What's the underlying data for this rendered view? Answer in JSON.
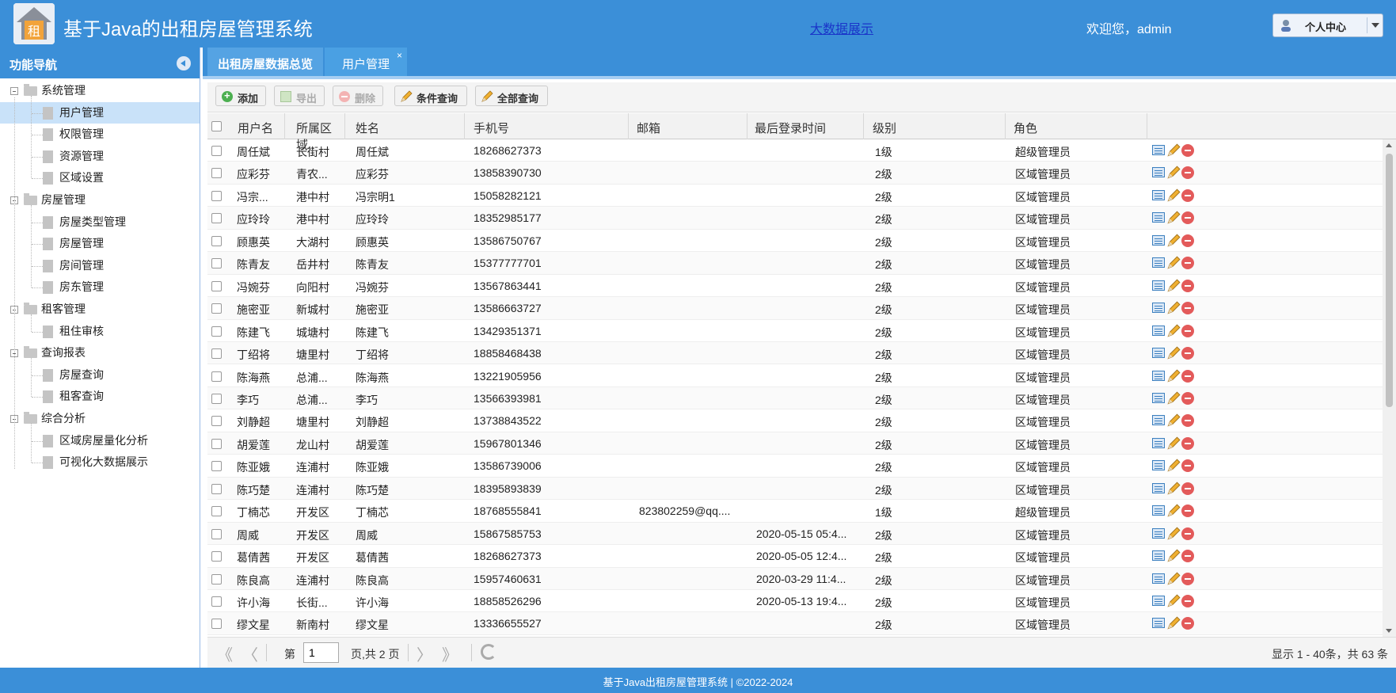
{
  "header": {
    "title": "基于Java的出租房屋管理系统",
    "bigdata_link": "大数据展示",
    "welcome": "欢迎您，admin",
    "user_center": "个人中心"
  },
  "sidebar": {
    "title": "功能导航",
    "groups": [
      {
        "label": "系统管理",
        "items": [
          "用户管理",
          "权限管理",
          "资源管理",
          "区域设置"
        ]
      },
      {
        "label": "房屋管理",
        "items": [
          "房屋类型管理",
          "房屋管理",
          "房间管理",
          "房东管理"
        ]
      },
      {
        "label": "租客管理",
        "items": [
          "租住审核"
        ]
      },
      {
        "label": "查询报表",
        "items": [
          "房屋查询",
          "租客查询"
        ]
      },
      {
        "label": "综合分析",
        "items": [
          "区域房屋量化分析",
          "可视化大数据展示"
        ]
      }
    ]
  },
  "tabs": [
    {
      "label": "出租房屋数据总览"
    },
    {
      "label": "用户管理",
      "close": "×"
    }
  ],
  "toolbar": {
    "add": "添加",
    "export": "导出",
    "delete": "删除",
    "condition_query": "条件查询",
    "all_query": "全部查询"
  },
  "grid": {
    "columns": [
      "用户名",
      "所属区域..",
      "姓名",
      "手机号",
      "邮箱",
      "最后登录时间",
      "级别",
      "角色"
    ],
    "rows": [
      [
        "周任斌",
        "长街村",
        "周任斌",
        "18268627373",
        "",
        "",
        "1级",
        "超级管理员"
      ],
      [
        "应彩芬",
        "青农...",
        "应彩芬",
        "13858390730",
        "",
        "",
        "2级",
        "区域管理员"
      ],
      [
        "冯宗...",
        "港中村",
        "冯宗明1",
        "15058282121",
        "",
        "",
        "2级",
        "区域管理员"
      ],
      [
        "应玲玲",
        "港中村",
        "应玲玲",
        "18352985177",
        "",
        "",
        "2级",
        "区域管理员"
      ],
      [
        "顾惠英",
        "大湖村",
        "顾惠英",
        "13586750767",
        "",
        "",
        "2级",
        "区域管理员"
      ],
      [
        "陈青友",
        "岳井村",
        "陈青友",
        "15377777701",
        "",
        "",
        "2级",
        "区域管理员"
      ],
      [
        "冯婉芬",
        "向阳村",
        "冯婉芬",
        "13567863441",
        "",
        "",
        "2级",
        "区域管理员"
      ],
      [
        "施密亚",
        "新城村",
        "施密亚",
        "13586663727",
        "",
        "",
        "2级",
        "区域管理员"
      ],
      [
        "陈建飞",
        "城塘村",
        "陈建飞",
        "13429351371",
        "",
        "",
        "2级",
        "区域管理员"
      ],
      [
        "丁绍将",
        "塘里村",
        "丁绍将",
        "18858468438",
        "",
        "",
        "2级",
        "区域管理员"
      ],
      [
        "陈海燕",
        "总浦...",
        "陈海燕",
        "13221905956",
        "",
        "",
        "2级",
        "区域管理员"
      ],
      [
        "李巧",
        "总浦...",
        "李巧",
        "13566393981",
        "",
        "",
        "2级",
        "区域管理员"
      ],
      [
        "刘静超",
        "塘里村",
        "刘静超",
        "13738843522",
        "",
        "",
        "2级",
        "区域管理员"
      ],
      [
        "胡爱莲",
        "龙山村",
        "胡爱莲",
        "15967801346",
        "",
        "",
        "2级",
        "区域管理员"
      ],
      [
        "陈亚娥",
        "连浦村",
        "陈亚娥",
        "13586739006",
        "",
        "",
        "2级",
        "区域管理员"
      ],
      [
        "陈巧楚",
        "连浦村",
        "陈巧楚",
        "18395893839",
        "",
        "",
        "2级",
        "区域管理员"
      ],
      [
        "丁楠芯",
        "开发区",
        "丁楠芯",
        "18768555841",
        "823802259@qq....",
        "",
        "1级",
        "超级管理员"
      ],
      [
        "周威",
        "开发区",
        "周威",
        "15867585753",
        "",
        "2020-05-15 05:4...",
        "2级",
        "区域管理员"
      ],
      [
        "葛倩茜",
        "开发区",
        "葛倩茜",
        "18268627373",
        "",
        "2020-05-05 12:4...",
        "2级",
        "区域管理员"
      ],
      [
        "陈良高",
        "连浦村",
        "陈良高",
        "15957460631",
        "",
        "2020-03-29 11:4...",
        "2级",
        "区域管理员"
      ],
      [
        "许小海",
        "长街...",
        "许小海",
        "18858526296",
        "",
        "2020-05-13 19:4...",
        "2级",
        "区域管理员"
      ],
      [
        "缪文星",
        "新南村",
        "缪文星",
        "13336655527",
        "",
        "",
        "2级",
        "区域管理员"
      ]
    ]
  },
  "pager": {
    "page_prefix": "第",
    "page_value": "1",
    "page_suffix": "页,共 2 页",
    "summary": "显示 1 - 40条，共 63 条"
  },
  "footer": {
    "text": "基于Java出租房屋管理系统 |   ©2022-2024"
  },
  "icons": {
    "first": "first-page-icon",
    "prev": "prev-page-icon",
    "next": "next-page-icon",
    "last": "last-page-icon",
    "refresh": "refresh-icon"
  },
  "colors": {
    "primary": "#3b8fd8",
    "selected": "#c9e2f9",
    "link": "#1a35c9",
    "delete": "#e35a5a"
  }
}
